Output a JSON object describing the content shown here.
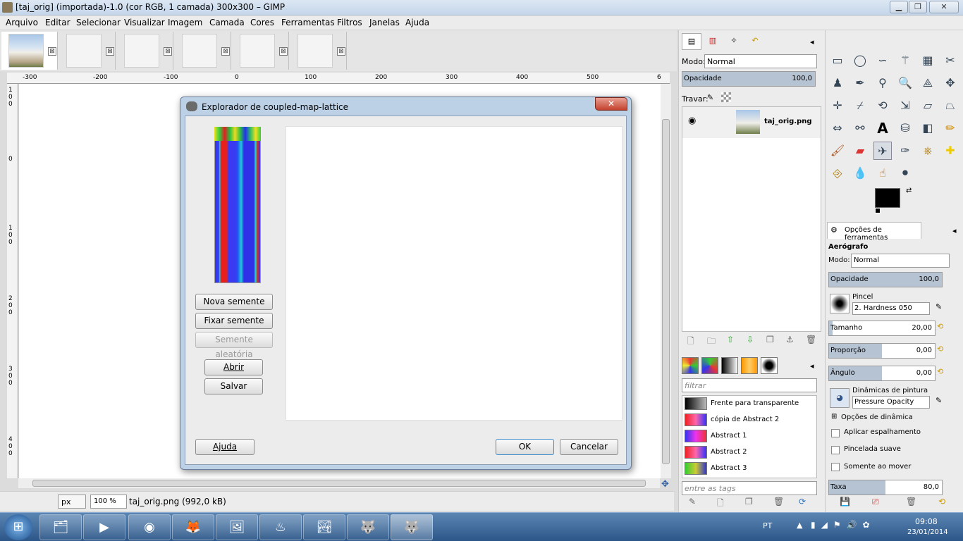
{
  "window": {
    "title": "[taj_orig] (importada)-1.0 (cor RGB, 1 camada) 300x300 – GIMP",
    "min": "▁",
    "max": "❐",
    "close": "✕"
  },
  "menu": [
    "Arquivo",
    "Editar",
    "Selecionar",
    "Visualizar",
    "Imagem",
    "Camada",
    "Cores",
    "Ferramentas",
    "Filtros",
    "Janelas",
    "Ajuda"
  ],
  "image_tabs": {
    "close_glyph": "⊠"
  },
  "ruler": {
    "h": [
      "-300",
      "-200",
      "-100",
      "0",
      "100",
      "200",
      "300",
      "400",
      "500",
      "6"
    ],
    "v": [
      "1 0 0",
      "0",
      "1 0 0",
      "2 0 0",
      "3 0 0",
      "4 0 0"
    ]
  },
  "status": {
    "unit": "px",
    "zoom": "100 %",
    "file": "taj_orig.png (992,0 kB)"
  },
  "dialog": {
    "title": "Explorador de coupled-map-lattice",
    "close": "✕",
    "new_seed": "Nova semente",
    "fix_seed": "Fixar semente",
    "random_seed": "Semente aleatória",
    "open": "Abrir",
    "save": "Salvar",
    "help": "Ajuda",
    "ok": "OK",
    "cancel": "Cancelar"
  },
  "layers": {
    "mode_label": "Modo:",
    "mode_value": "Normal",
    "opacity_label": "Opacidade",
    "opacity_value": "100,0",
    "lock_label": "Travar:",
    "layer_name": "taj_orig.png"
  },
  "gradients": {
    "filter_placeholder": "filtrar",
    "items": [
      "Frente para transparente",
      "cópia de Abstract 2",
      "Abstract 1",
      "Abstract 2",
      "Abstract 3"
    ],
    "tags_placeholder": "entre as tags"
  },
  "tool_options": {
    "tab_title": "Opções de ferramentas",
    "tool_name": "Aerógrafo",
    "mode_label": "Modo:",
    "mode_value": "Normal",
    "opacity_label": "Opacidade",
    "opacity_value": "100,0",
    "brush_label": "Pincel",
    "brush_value": "2. Hardness 050",
    "size_label": "Tamanho",
    "size_value": "20,00",
    "ratio_label": "Proporção",
    "ratio_value": "0,00",
    "angle_label": "Ângulo",
    "angle_value": "0,00",
    "dynamics_label": "Dinâmicas de pintura",
    "dynamics_value": "Pressure Opacity",
    "dynamics_options": "Opções de dinâmica",
    "apply_jitter": "Aplicar espalhamento",
    "smooth": "Pincelada suave",
    "only_move": "Somente ao mover",
    "rate_label": "Taxa",
    "rate_value": "80,0",
    "expand": "⊞"
  },
  "taskbar": {
    "lang": "PT",
    "time": "09:08",
    "date": "23/01/2014",
    "start": "⊞",
    "apps": [
      "🗂",
      "▶",
      "◉",
      "🦊",
      "🖼",
      "♨",
      "🏞",
      "🐺",
      "🐺"
    ]
  }
}
